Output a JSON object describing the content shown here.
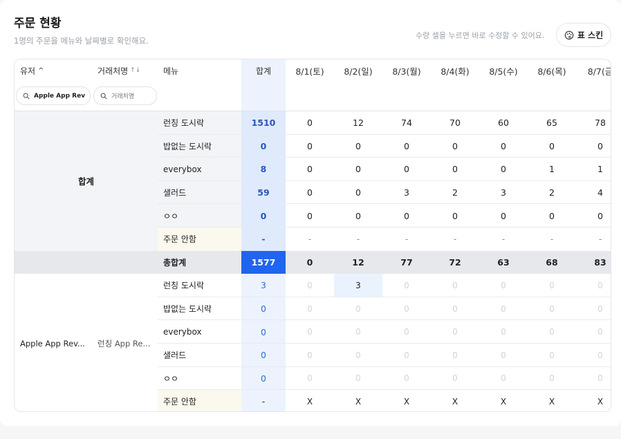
{
  "header": {
    "title": "주문 현황",
    "subtitle": "1명의 주문을 메뉴와 날짜별로 확인해요.",
    "hint": "수량 셀을 누르면 바로 수정할 수 있어요.",
    "skin_button": "표 스킨"
  },
  "columns": {
    "user": "유저",
    "user_sort": "^",
    "vendor": "거래처명",
    "vendor_sort": "↑↓",
    "menu": "메뉴",
    "total": "합계",
    "dates": [
      "8/1(토)",
      "8/2(일)",
      "8/3(월)",
      "8/4(화)",
      "8/5(수)",
      "8/6(목)",
      "8/7(금"
    ]
  },
  "filters": {
    "user_value": "Apple App Rev",
    "vendor_placeholder": "거래처명"
  },
  "summary_group": {
    "label": "합계",
    "rows": [
      {
        "menu": "런칭 도시락",
        "total": "1510",
        "values": [
          "0",
          "12",
          "74",
          "70",
          "60",
          "65",
          "78"
        ]
      },
      {
        "menu": "밥없는 도시락",
        "total": "0",
        "values": [
          "0",
          "0",
          "0",
          "0",
          "0",
          "0",
          "0"
        ]
      },
      {
        "menu": "everybox",
        "total": "8",
        "values": [
          "0",
          "0",
          "0",
          "0",
          "0",
          "1",
          "1"
        ]
      },
      {
        "menu": "샐러드",
        "total": "59",
        "values": [
          "0",
          "0",
          "3",
          "2",
          "3",
          "2",
          "4"
        ]
      },
      {
        "menu": "ㅇㅇ",
        "total": "0",
        "values": [
          "0",
          "0",
          "0",
          "0",
          "0",
          "0",
          "0"
        ]
      },
      {
        "menu": "주문 안함",
        "total": "-",
        "values": [
          "-",
          "-",
          "-",
          "-",
          "-",
          "-",
          "-"
        ]
      }
    ]
  },
  "grand_total": {
    "label": "총합계",
    "total": "1577",
    "values": [
      "0",
      "12",
      "77",
      "72",
      "63",
      "68",
      "83"
    ]
  },
  "user_group": {
    "user": "Apple App Rev...",
    "vendor": "런칭 App Re...",
    "rows": [
      {
        "menu": "런칭 도시락",
        "total": "3",
        "values": [
          "0",
          "3",
          "0",
          "0",
          "0",
          "0",
          "0"
        ]
      },
      {
        "menu": "밥없는 도시락",
        "total": "0",
        "values": [
          "0",
          "0",
          "0",
          "0",
          "0",
          "0",
          "0"
        ]
      },
      {
        "menu": "everybox",
        "total": "0",
        "values": [
          "0",
          "0",
          "0",
          "0",
          "0",
          "0",
          "0"
        ]
      },
      {
        "menu": "샐러드",
        "total": "0",
        "values": [
          "0",
          "0",
          "0",
          "0",
          "0",
          "0",
          "0"
        ]
      },
      {
        "menu": "ㅇㅇ",
        "total": "0",
        "values": [
          "0",
          "0",
          "0",
          "0",
          "0",
          "0",
          "0"
        ]
      },
      {
        "menu": "주문 안함",
        "total": "-",
        "values": [
          "X",
          "X",
          "X",
          "X",
          "X",
          "X",
          "X"
        ]
      }
    ]
  },
  "colors": {
    "accent": "#1f65f0",
    "sum_text": "#2e55b8",
    "total_column_bg": "#ecf3fe",
    "no_order_bg": "#fbf9ee"
  }
}
